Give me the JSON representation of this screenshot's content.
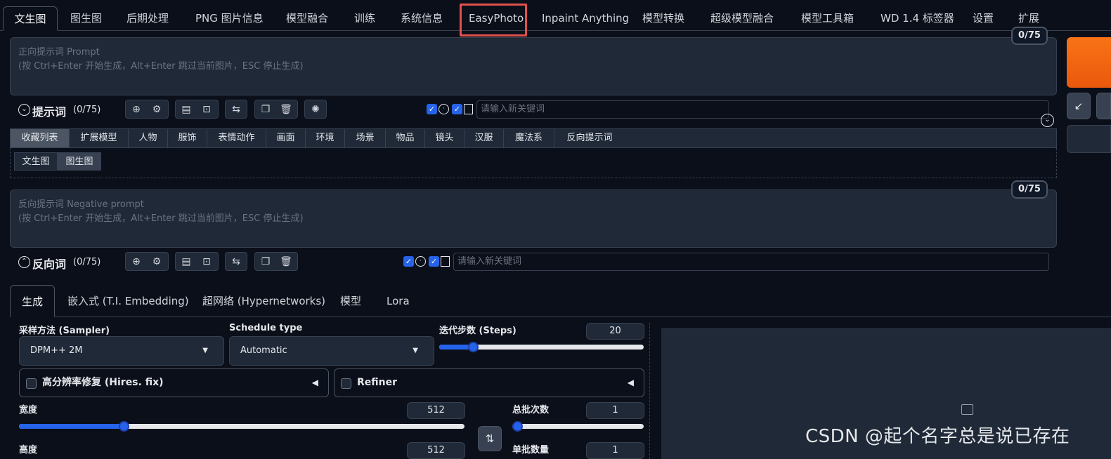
{
  "top_tabs": [
    {
      "label": "文生图",
      "active": true
    },
    {
      "label": "图生图"
    },
    {
      "label": "后期处理"
    },
    {
      "label": "PNG 图片信息"
    },
    {
      "label": "模型融合"
    },
    {
      "label": "训练"
    },
    {
      "label": "系统信息"
    },
    {
      "label": "EasyPhoto",
      "highlighted": true
    },
    {
      "label": "Inpaint Anything"
    },
    {
      "label": "模型转换"
    },
    {
      "label": "超级模型融合"
    },
    {
      "label": "模型工具箱"
    },
    {
      "label": "WD 1.4 标签器"
    },
    {
      "label": "设置"
    },
    {
      "label": "扩展"
    }
  ],
  "prompt": {
    "counter": "0/75",
    "placeholder_line1": "正向提示词 Prompt",
    "placeholder_line2": "(按 Ctrl+Enter 开始生成，Alt+Enter 跳过当前图片，ESC 停止生成)",
    "label": "提示词",
    "count": "(0/75)",
    "keyword_placeholder": "请输入新关键词"
  },
  "categories": [
    "收藏列表",
    "扩展模型",
    "人物",
    "服饰",
    "表情动作",
    "画面",
    "环境",
    "场景",
    "物品",
    "镜头",
    "汉服",
    "魔法系",
    "反向提示词"
  ],
  "sub_tabs": [
    "文生图",
    "图生图"
  ],
  "negative": {
    "counter": "0/75",
    "placeholder_line1": "反向提示词 Negative prompt",
    "placeholder_line2": "(按 Ctrl+Enter 开始生成，Alt+Enter 跳过当前图片，ESC 停止生成)",
    "label": "反向词",
    "count": "(0/75)",
    "keyword_placeholder": "请输入新关键词"
  },
  "bottom_tabs": [
    "生成",
    "嵌入式 (T.I. Embedding)",
    "超网络 (Hypernetworks)",
    "模型",
    "Lora"
  ],
  "params": {
    "sampler_label": "采样方法 (Sampler)",
    "sampler_value": "DPM++ 2M",
    "schedule_label": "Schedule type",
    "schedule_value": "Automatic",
    "steps_label": "迭代步数 (Steps)",
    "steps_value": "20",
    "hires_label": "高分辨率修复 (Hires. fix)",
    "refiner_label": "Refiner",
    "width_label": "宽度",
    "width_value": "512",
    "height_label": "高度",
    "height_value": "512",
    "batch_count_label": "总批次数",
    "batch_count_value": "1",
    "batch_size_label": "单批数量",
    "batch_size_value": "1"
  },
  "slider_levels": {
    "steps": 0.15,
    "width": 0.23,
    "batch_count": 0.0
  },
  "watermark": "CSDN @起个名字总是说已存在",
  "colors": {
    "accent": "#2563eb",
    "generate": "#f97316",
    "highlight": "#e0514d",
    "background": "#0b0f19"
  }
}
